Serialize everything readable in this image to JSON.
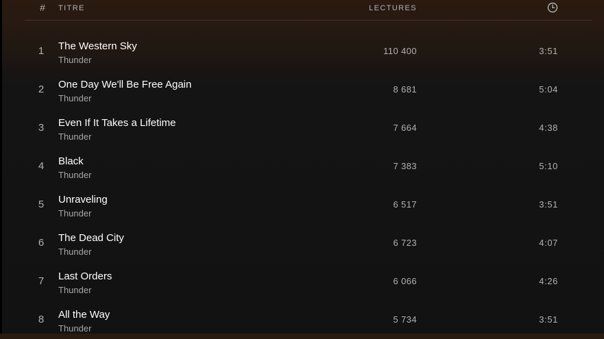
{
  "header": {
    "number_label": "#",
    "title_label": "TITRE",
    "plays_label": "LECTURES",
    "duration_icon": "clock-icon"
  },
  "tracks": [
    {
      "number": "1",
      "title": "The Western Sky",
      "artist": "Thunder",
      "plays": "110 400",
      "duration": "3:51"
    },
    {
      "number": "2",
      "title": "One Day We'll Be Free Again",
      "artist": "Thunder",
      "plays": "8 681",
      "duration": "5:04"
    },
    {
      "number": "3",
      "title": "Even If It Takes a Lifetime",
      "artist": "Thunder",
      "plays": "7 664",
      "duration": "4:38"
    },
    {
      "number": "4",
      "title": "Black",
      "artist": "Thunder",
      "plays": "7 383",
      "duration": "5:10"
    },
    {
      "number": "5",
      "title": "Unraveling",
      "artist": "Thunder",
      "plays": "6 517",
      "duration": "3:51"
    },
    {
      "number": "6",
      "title": "The Dead City",
      "artist": "Thunder",
      "plays": "6 723",
      "duration": "4:07"
    },
    {
      "number": "7",
      "title": "Last Orders",
      "artist": "Thunder",
      "plays": "6 066",
      "duration": "4:26"
    },
    {
      "number": "8",
      "title": "All the Way",
      "artist": "Thunder",
      "plays": "5 734",
      "duration": "3:51"
    }
  ],
  "colors": {
    "background": "#121212",
    "header_gradient_top": "#2a1a10",
    "text_primary": "#ffffff",
    "text_secondary": "#b3b3b3"
  }
}
